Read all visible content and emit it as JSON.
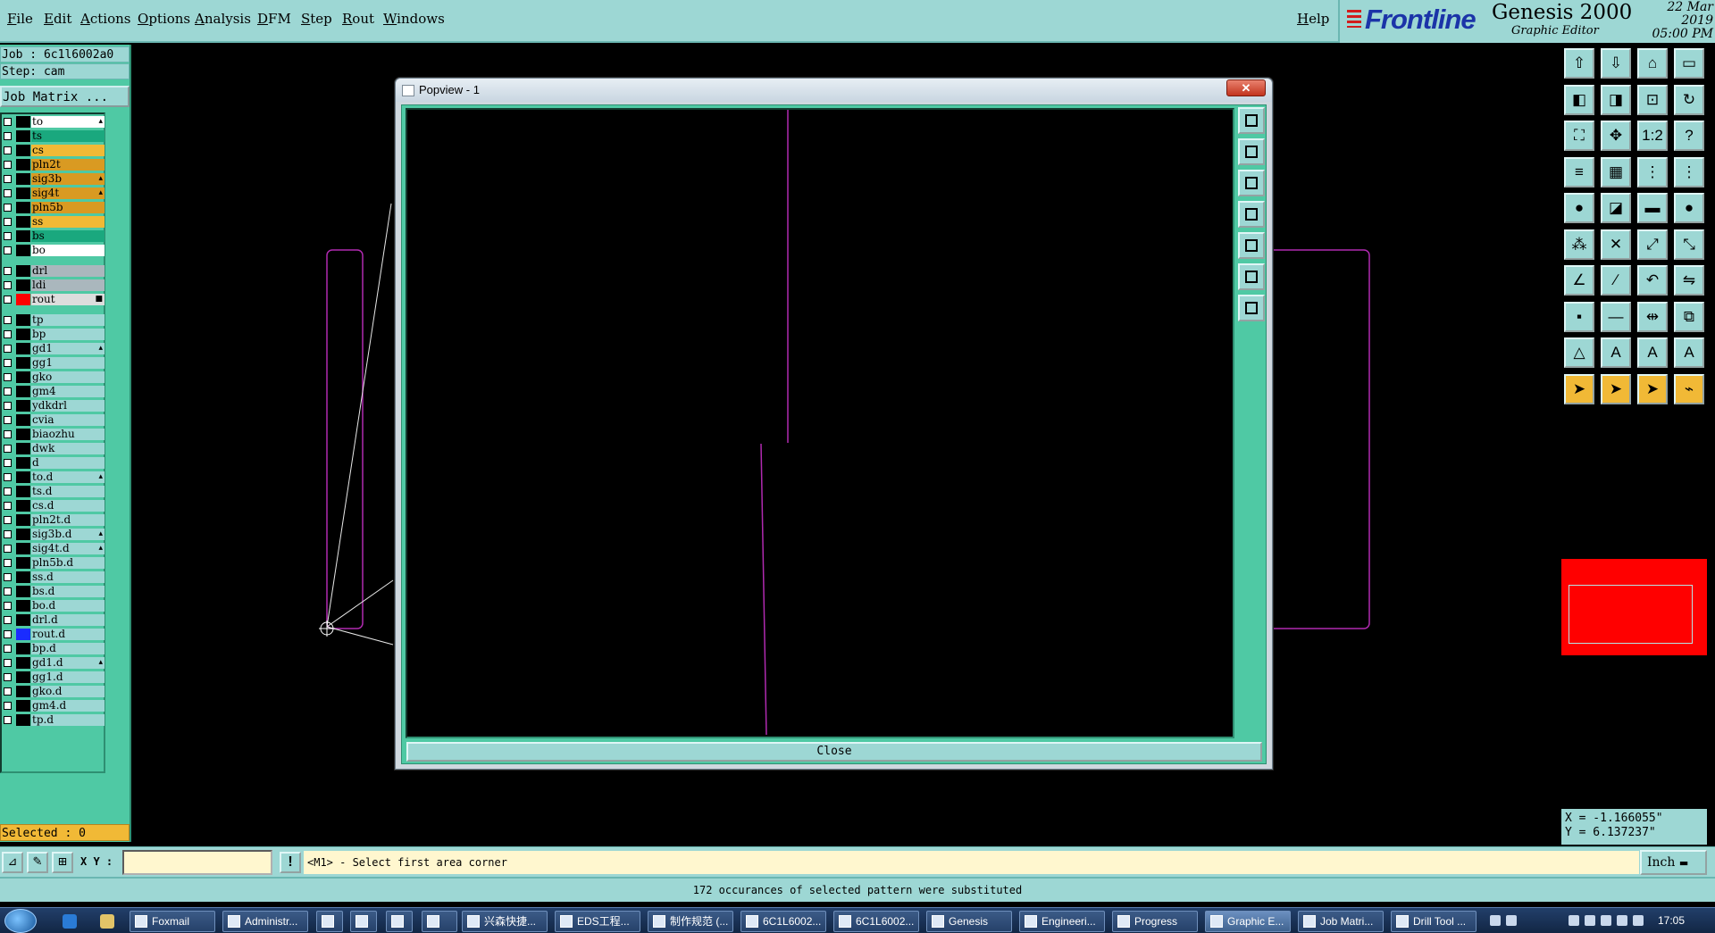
{
  "menu": {
    "items": [
      "File",
      "Edit",
      "Actions",
      "Options",
      "Analysis",
      "DFM",
      "Step",
      "Rout",
      "Windows"
    ],
    "help": "Help"
  },
  "brand": {
    "logo": "Frontline",
    "product": "Genesis 2000",
    "subtitle": "Graphic Editor",
    "date": "22 Mar 2019",
    "time": "05:00 PM"
  },
  "job_info": {
    "job": "Job : 6c1l6002a0",
    "step": "Step: cam",
    "matrix_button": "Job Matrix ..."
  },
  "layers": [
    {
      "name": "to",
      "color": "#ffffff",
      "mark": "▴"
    },
    {
      "name": "ts",
      "color": "#1aa87e",
      "mark": ""
    },
    {
      "name": "cs",
      "color": "#f1b936",
      "mark": ""
    },
    {
      "name": "pln2t",
      "color": "#d99a22",
      "mark": ""
    },
    {
      "name": "sig3b",
      "color": "#d99a22",
      "mark": "▴"
    },
    {
      "name": "sig4t",
      "color": "#d99a22",
      "mark": "▴"
    },
    {
      "name": "pln5b",
      "color": "#d99a22",
      "mark": ""
    },
    {
      "name": "ss",
      "color": "#f1b936",
      "mark": ""
    },
    {
      "name": "bs",
      "color": "#1aa87e",
      "mark": ""
    },
    {
      "name": "bo",
      "color": "#ffffff",
      "mark": ""
    },
    {
      "name": "drl",
      "color": "#aab7bd",
      "mark": ""
    },
    {
      "name": "ldi",
      "color": "#aab7bd",
      "mark": ""
    },
    {
      "name": "rout",
      "color": "#dddddd",
      "mark": "■",
      "swatch": "#ff0000"
    },
    {
      "name": "tp",
      "color": "#9dd7d4",
      "mark": ""
    },
    {
      "name": "bp",
      "color": "#9dd7d4",
      "mark": ""
    },
    {
      "name": "gd1",
      "color": "#9dd7d4",
      "mark": "▴"
    },
    {
      "name": "gg1",
      "color": "#9dd7d4",
      "mark": ""
    },
    {
      "name": "gko",
      "color": "#9dd7d4",
      "mark": ""
    },
    {
      "name": "gm4",
      "color": "#9dd7d4",
      "mark": ""
    },
    {
      "name": "ydkdrl",
      "color": "#9dd7d4",
      "mark": ""
    },
    {
      "name": "cvia",
      "color": "#9dd7d4",
      "mark": ""
    },
    {
      "name": "biaozhu",
      "color": "#9dd7d4",
      "mark": ""
    },
    {
      "name": "dwk",
      "color": "#9dd7d4",
      "mark": ""
    },
    {
      "name": "d",
      "color": "#9dd7d4",
      "mark": ""
    },
    {
      "name": "to.d",
      "color": "#9dd7d4",
      "mark": "▴"
    },
    {
      "name": "ts.d",
      "color": "#9dd7d4",
      "mark": ""
    },
    {
      "name": "cs.d",
      "color": "#9dd7d4",
      "mark": ""
    },
    {
      "name": "pln2t.d",
      "color": "#9dd7d4",
      "mark": ""
    },
    {
      "name": "sig3b.d",
      "color": "#9dd7d4",
      "mark": "▴"
    },
    {
      "name": "sig4t.d",
      "color": "#9dd7d4",
      "mark": "▴"
    },
    {
      "name": "pln5b.d",
      "color": "#9dd7d4",
      "mark": ""
    },
    {
      "name": "ss.d",
      "color": "#9dd7d4",
      "mark": ""
    },
    {
      "name": "bs.d",
      "color": "#9dd7d4",
      "mark": ""
    },
    {
      "name": "bo.d",
      "color": "#9dd7d4",
      "mark": ""
    },
    {
      "name": "drl.d",
      "color": "#9dd7d4",
      "mark": ""
    },
    {
      "name": "rout.d",
      "color": "#9dd7d4",
      "mark": "",
      "swatch": "#1a2cff"
    },
    {
      "name": "bp.d",
      "color": "#9dd7d4",
      "mark": ""
    },
    {
      "name": "gd1.d",
      "color": "#9dd7d4",
      "mark": "▴"
    },
    {
      "name": "gg1.d",
      "color": "#9dd7d4",
      "mark": ""
    },
    {
      "name": "gko.d",
      "color": "#9dd7d4",
      "mark": ""
    },
    {
      "name": "gm4.d",
      "color": "#9dd7d4",
      "mark": ""
    },
    {
      "name": "tp.d",
      "color": "#9dd7d4",
      "mark": ""
    }
  ],
  "selected": "Selected : 0",
  "coords": {
    "x": "X = -1.166055\"",
    "y": "Y = 6.137237\""
  },
  "prompt": {
    "xy_label": "X Y :",
    "xy_value": "",
    "message": "<M1> - Select first area corner",
    "unit": "Inch"
  },
  "status": "172 occurances of selected pattern were substituted",
  "popview": {
    "title": "Popview - 1",
    "close_x": "✕",
    "close_button": "Close"
  },
  "tools": [
    "layer-up-icon",
    "layer-down-icon",
    "home-icon",
    "window-icon",
    "pan-left-icon",
    "pan-right-icon",
    "fit-icon",
    "redraw-icon",
    "zoom-fit-icon",
    "zoom-center-icon",
    "scale-1-2-icon",
    "help-icon",
    "measure-icon",
    "grid-icon",
    "snap-icon",
    "snap-alt-icon",
    "pad-icon",
    "line-select-icon",
    "ruler-icon",
    "dot-icon",
    "connect-icon",
    "delete-icon",
    "move-icon",
    "copy-icon",
    "angle-icon",
    "slash-icon",
    "arc-icon",
    "mirror-icon",
    "add-pad-icon",
    "line-icon",
    "resize-icon",
    "symbol-icon",
    "triangle-icon",
    "text-a-icon",
    "text-a2-icon",
    "text-a3-icon",
    "pointer-icon",
    "select-icon",
    "select-alt-icon",
    "route-icon"
  ],
  "taskbar": {
    "tasks": [
      "Foxmail",
      "Administr...",
      "",
      "",
      "",
      "",
      "兴森快捷...",
      "EDS工程...",
      "制作规范 (...",
      "6C1L6002...",
      "6C1L6002...",
      "Genesis",
      "Engineeri...",
      "Progress",
      "Graphic E...",
      "Job Matri...",
      "Drill Tool ..."
    ],
    "clock": "17:05"
  }
}
